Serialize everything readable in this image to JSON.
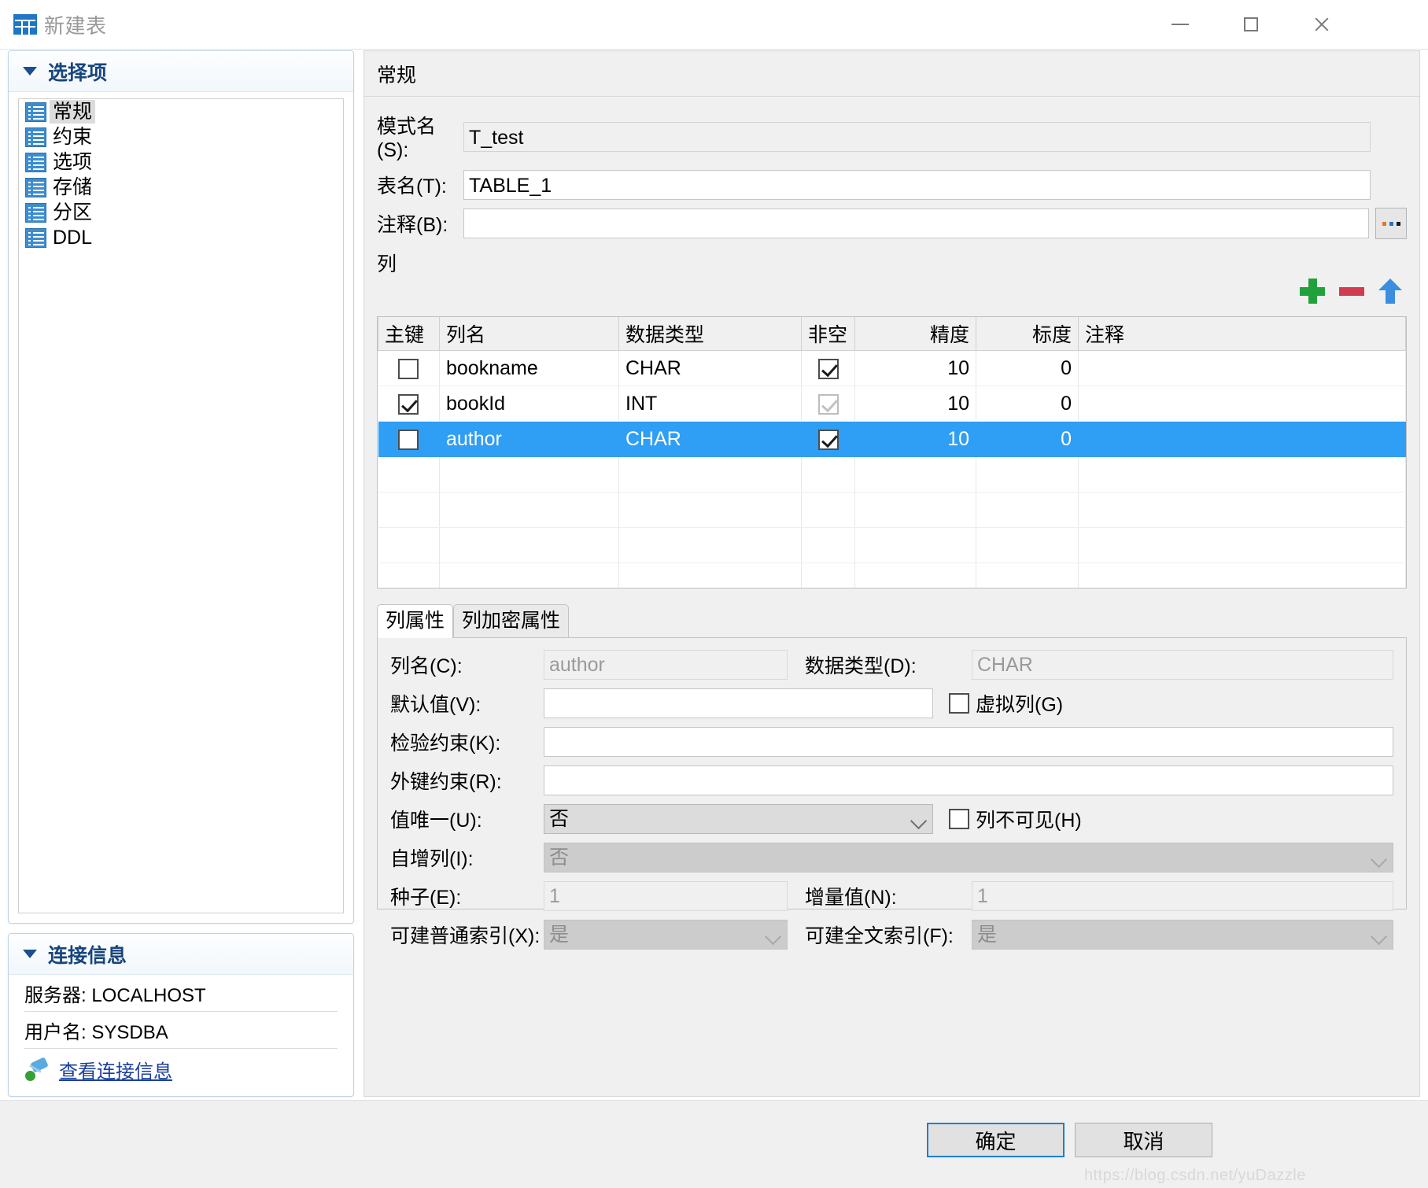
{
  "window": {
    "title": "新建表",
    "icon": "table-icon",
    "controls": {
      "minimize": "minimize-icon",
      "maximize": "maximize-icon",
      "close": "close-icon"
    }
  },
  "sidebar": {
    "options_section": {
      "title": "选择项",
      "expanded": true,
      "items": [
        {
          "label": "常规",
          "selected": true
        },
        {
          "label": "约束",
          "selected": false
        },
        {
          "label": "选项",
          "selected": false
        },
        {
          "label": "存储",
          "selected": false
        },
        {
          "label": "分区",
          "selected": false
        },
        {
          "label": "DDL",
          "selected": false
        }
      ]
    },
    "connection_section": {
      "title": "连接信息",
      "expanded": true,
      "server": "服务器: LOCALHOST",
      "username": "用户名: SYSDBA",
      "link": "查看连接信息"
    }
  },
  "main": {
    "page_title": "常规",
    "fields": {
      "schema_label": "模式名(S):",
      "schema_value": "T_test",
      "table_label": "表名(T):",
      "table_value": "TABLE_1",
      "comment_label": "注释(B):",
      "comment_value": "",
      "browse_button": "..."
    },
    "columns_label": "列",
    "toolbar": {
      "add": "plus-icon",
      "remove": "minus-icon",
      "move_up": "arrow-up-icon"
    },
    "grid": {
      "headers": [
        "主键",
        "列名",
        "数据类型",
        "非空",
        "精度",
        "标度",
        "注释"
      ],
      "rows": [
        {
          "pk": false,
          "name": "bookname",
          "type": "CHAR",
          "notnull": true,
          "notnull_disabled": false,
          "precision": "10",
          "scale": "0",
          "comment": "",
          "selected": false
        },
        {
          "pk": true,
          "name": "bookId",
          "type": "INT",
          "notnull": true,
          "notnull_disabled": true,
          "precision": "10",
          "scale": "0",
          "comment": "",
          "selected": false
        },
        {
          "pk": false,
          "name": "author",
          "type": "CHAR",
          "notnull": true,
          "notnull_disabled": false,
          "precision": "10",
          "scale": "0",
          "comment": "",
          "selected": true
        }
      ],
      "empty_rows": 4
    },
    "tabs": [
      {
        "label": "列属性",
        "active": true
      },
      {
        "label": "列加密属性",
        "active": false
      }
    ],
    "properties": {
      "col_name_label": "列名(C):",
      "col_name_value": "author",
      "data_type_label": "数据类型(D):",
      "data_type_value": "CHAR",
      "default_label": "默认值(V):",
      "default_value": "",
      "virtual_col_label": "虚拟列(G)",
      "virtual_col_checked": false,
      "check_constraint_label": "检验约束(K):",
      "check_constraint_value": "",
      "foreign_key_label": "外键约束(R):",
      "foreign_key_value": "",
      "unique_label": "值唯一(U):",
      "unique_value": "否",
      "invisible_col_label": "列不可见(H)",
      "invisible_col_checked": false,
      "identity_label": "自增列(I):",
      "identity_value": "否",
      "seed_label": "种子(E):",
      "seed_value": "1",
      "increment_label": "增量值(N):",
      "increment_value": "1",
      "normal_index_label": "可建普通索引(X):",
      "normal_index_value": "是",
      "fulltext_index_label": "可建全文索引(F):",
      "fulltext_index_value": "是"
    }
  },
  "footer": {
    "ok": "确定",
    "cancel": "取消"
  },
  "watermark": "https://blog.csdn.net/yuDazzle",
  "colors": {
    "accent": "#2f9ef5",
    "section_title": "#17457d",
    "add": "#21a13b",
    "remove": "#d33b52",
    "moveup": "#3b8de0"
  }
}
